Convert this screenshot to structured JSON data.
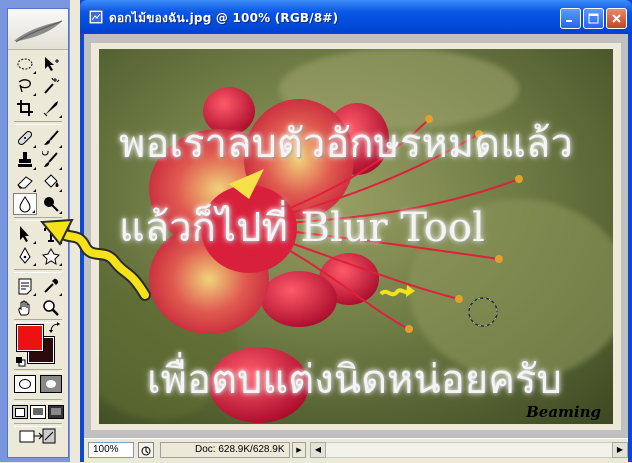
{
  "document": {
    "title": "ดอกไม้ของฉัน.jpg @ 100% (RGB/8#)",
    "zoom": "100%",
    "doc_size": "Doc: 628.9K/628.9K"
  },
  "image_text": {
    "line1": "พอเราลบตัวอักษรหมดแล้ว",
    "line2": "แล้วก็ไปที่   Blur  Tool",
    "line3": "เพื่อตบแต่งนิดหน่อยครับ",
    "signature": "Beaming"
  },
  "toolbox": {
    "tools": [
      {
        "name": "marquee-tool-icon"
      },
      {
        "name": "move-tool-icon"
      },
      {
        "name": "lasso-tool-icon"
      },
      {
        "name": "magic-wand-tool-icon"
      },
      {
        "name": "crop-tool-icon"
      },
      {
        "name": "slice-tool-icon"
      },
      {
        "name": "healing-brush-tool-icon"
      },
      {
        "name": "brush-tool-icon"
      },
      {
        "name": "clone-stamp-tool-icon"
      },
      {
        "name": "history-brush-tool-icon"
      },
      {
        "name": "eraser-tool-icon"
      },
      {
        "name": "paint-bucket-tool-icon"
      },
      {
        "name": "blur-tool-icon",
        "active": true
      },
      {
        "name": "dodge-tool-icon"
      },
      {
        "name": "path-selection-tool-icon"
      },
      {
        "name": "type-tool-icon"
      },
      {
        "name": "pen-tool-icon"
      },
      {
        "name": "shape-tool-icon"
      },
      {
        "name": "notes-tool-icon"
      },
      {
        "name": "eyedropper-tool-icon"
      },
      {
        "name": "hand-tool-icon"
      },
      {
        "name": "zoom-tool-icon"
      }
    ],
    "foreground_color": "#ee1111",
    "background_color": "#2a0a0a"
  },
  "colors": {
    "titlebar": "#0a57e6",
    "annotation_arrow": "#f5e21a"
  }
}
